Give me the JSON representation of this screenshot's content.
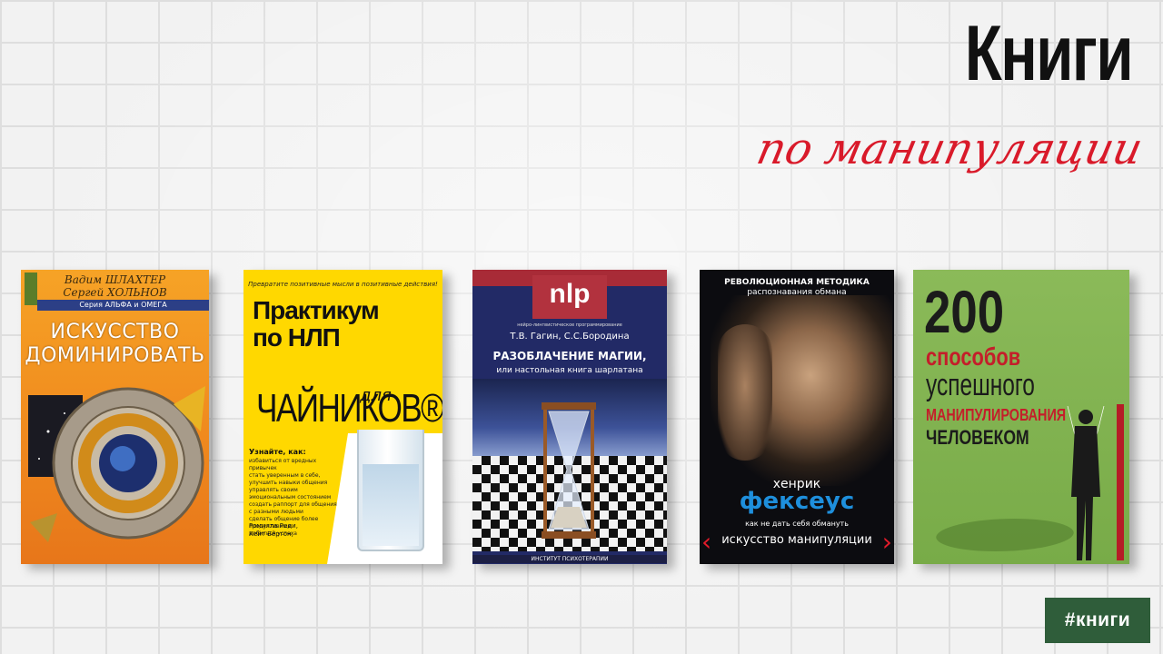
{
  "header": {
    "title": "Книги",
    "subtitle": "по манипуляции"
  },
  "books": [
    {
      "authors": [
        "Вадим ШЛАХТЕР",
        "Сергей ХОЛЬНОВ"
      ],
      "series": "Серия АЛЬФА и ОМЕГА",
      "title_lines": [
        "ИСКУССТВО",
        "ДОМИНИРОВАТЬ"
      ]
    },
    {
      "tagline": "Превратите позитивные мысли в позитивные действия!",
      "title_lines": [
        "Практикум",
        "по НЛП"
      ],
      "dlya": "для",
      "chainikov": "ЧАЙНИКОВ®",
      "learn_heading": "Узнайте, как:",
      "bullets": [
        "избавиться от вредных привычек",
        "стать уверенным в себе, улучшить навыки общения",
        "управлять своим эмоциональным состоянием",
        "создать раппорт для общения с разными людьми",
        "сделать общение более продуктивным",
        "добиться успеха"
      ],
      "authors": [
        "Ромилла Реди,",
        "Кейт Бёртон,"
      ]
    },
    {
      "logo": "nlp",
      "logo_sub": "нейро-лингвистическое программирование",
      "authors": "Т.В. Гагин, С.С.Бородина",
      "title_main": "РАЗОБЛАЧЕНИЕ МАГИИ,",
      "title_sub": "или настольная книга шарлатана",
      "publisher": "ИНСТИТУТ ПСИХОТЕРАПИИ"
    },
    {
      "kicker_line1": "РЕВОЛЮЦИОННАЯ МЕТОДИКА",
      "kicker_line2": "распознавания обмана",
      "author_first": "хенрик",
      "author_last": "фексеус",
      "tagline": "как не дать себя обмануть",
      "title": "искусство манипуляции"
    },
    {
      "number": "200",
      "line1": "способов",
      "line2": "успешного",
      "line3": "МАНИПУЛИРОВАНИЯ",
      "line4": "ЧЕЛОВЕКОМ"
    }
  ],
  "hashtag": "#книги",
  "colors": {
    "subtitle_red": "#d91a2a",
    "hashtag_bg": "#2f5d3a",
    "fekseus_blue": "#1e8fdc"
  }
}
